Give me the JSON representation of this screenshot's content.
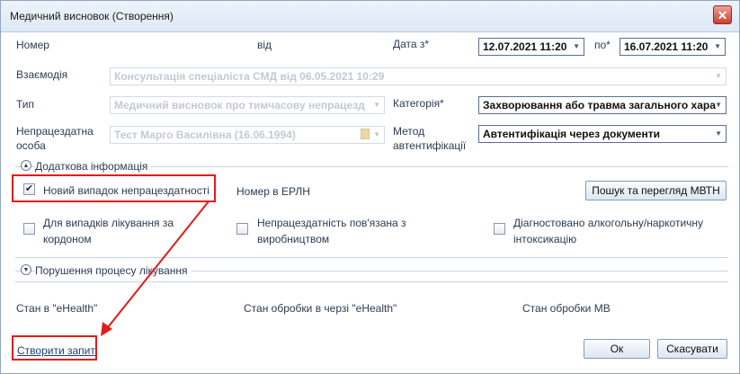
{
  "window": {
    "title": "Медичний висновок (Створення)"
  },
  "form": {
    "number_label": "Номер",
    "from_label": "від",
    "date_from_label": "Дата з*",
    "date_from_value": "12.07.2021 11:20",
    "date_to_label": "по*",
    "date_to_value": "16.07.2021 11:20",
    "interaction_label": "Взаємодія",
    "interaction_value": "Консультація спеціаліста СМД від 06.05.2021 10:29",
    "type_label": "Тип",
    "type_value": "Медичний висновок про тимчасову непрацезд",
    "category_label": "Категорія*",
    "category_value": "Захворювання або травма загального хара",
    "person_label_line1": "Непрацездатна",
    "person_label_line2": "особа",
    "person_value": "Тест Марго Василівна (16.06.1994)",
    "auth_label_line1": "Метод",
    "auth_label_line2": "автентифікації",
    "auth_value": "Автентифікація через документи"
  },
  "additional": {
    "header": "Додаткова інформація",
    "new_case_label": "Новий випадок непрацездатності",
    "new_case_checked": true,
    "erln_label": "Номер в ЕРЛН",
    "search_button": "Пошук та перегляд МВТН",
    "abroad_line1": "Для випадків лікування за",
    "abroad_line2": "кордоном",
    "abroad_checked": false,
    "production_line1": "Непрацездатність пов'язана з",
    "production_line2": "виробництвом",
    "production_checked": false,
    "alcohol_line1": "Діагностовано алкогольну/наркотичну",
    "alcohol_line2": "інтоксикацію",
    "alcohol_checked": false
  },
  "violation": {
    "header": "Порушення процесу лікування"
  },
  "status": {
    "ehealth_label": "Стан в \"eHealth\"",
    "queue_label": "Стан обробки в черзі \"eHealth\"",
    "mv_label": "Стан обробки МВ"
  },
  "footer": {
    "create_request": "Створити запит",
    "ok": "Ок",
    "cancel": "Скасувати"
  },
  "icons": {
    "close": "close-icon",
    "dropdown": "chevron-down-icon",
    "expand_up": "chevron-up-icon",
    "expand_down": "chevron-down-icon",
    "edit": "pencil-icon"
  },
  "colors": {
    "annotation": "#e31b1b",
    "close_button": "#c8412f"
  }
}
